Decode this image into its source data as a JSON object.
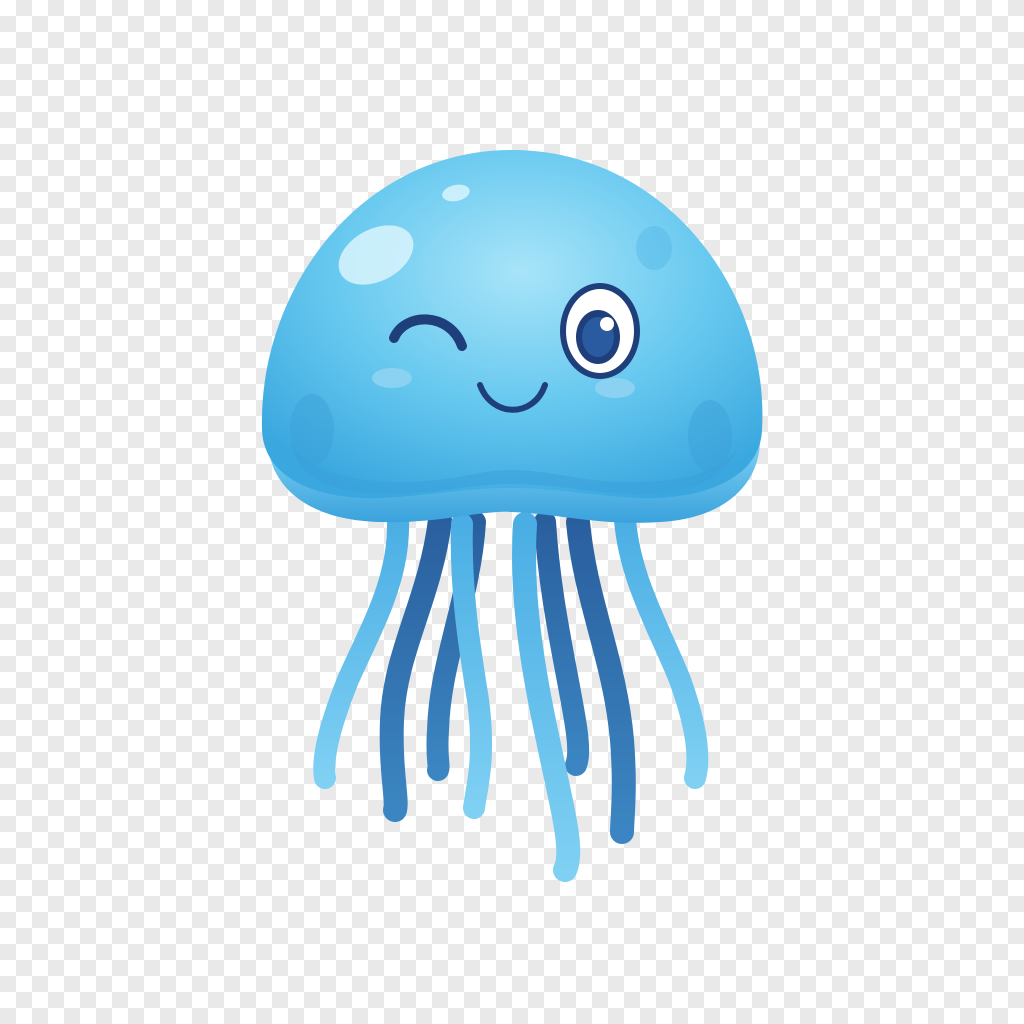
{
  "image": {
    "subject": "jellyfish-character",
    "background": "transparency-checkerboard",
    "expression": "winking-smile",
    "colors": {
      "checker_light": "#ffffff",
      "checker_dark": "#e9e9e9",
      "bell_light": "#9fe0f7",
      "bell_main": "#5cc4ee",
      "bell_dark": "#2f9fd8",
      "rim": "#4db3e6",
      "tentacle_light": "#56b9ea",
      "tentacle_dark": "#2c6fae",
      "eye_navy": "#1f3f7a",
      "blush": "#8fd3f2"
    }
  }
}
